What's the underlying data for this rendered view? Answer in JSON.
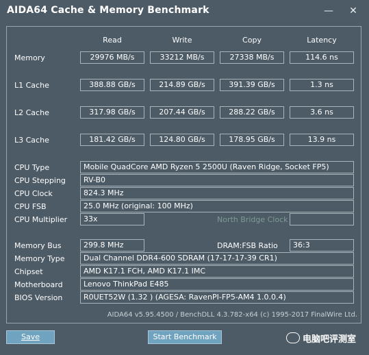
{
  "window": {
    "title": "AIDA64 Cache & Memory Benchmark",
    "minimize_glyph": "—",
    "close_glyph": "✕"
  },
  "headers": [
    "Read",
    "Write",
    "Copy",
    "Latency"
  ],
  "rows": [
    {
      "label": "Memory",
      "values": [
        "29976 MB/s",
        "33212 MB/s",
        "27338 MB/s",
        "114.6 ns"
      ]
    },
    {
      "label": "L1 Cache",
      "values": [
        "388.88 GB/s",
        "214.89 GB/s",
        "391.39 GB/s",
        "1.3 ns"
      ]
    },
    {
      "label": "L2 Cache",
      "values": [
        "317.98 GB/s",
        "207.44 GB/s",
        "288.22 GB/s",
        "3.6 ns"
      ]
    },
    {
      "label": "L3 Cache",
      "values": [
        "181.42 GB/s",
        "124.80 GB/s",
        "178.95 GB/s",
        "13.9 ns"
      ]
    }
  ],
  "info": {
    "cpu_type": {
      "label": "CPU Type",
      "value": "Mobile QuadCore AMD Ryzen 5 2500U  (Raven Ridge, Socket FP5)"
    },
    "cpu_stepping": {
      "label": "CPU Stepping",
      "value": "RV-B0"
    },
    "cpu_clock": {
      "label": "CPU Clock",
      "value": "824.3 MHz"
    },
    "cpu_fsb": {
      "label": "CPU FSB",
      "value": "25.0 MHz  (original: 100 MHz)"
    },
    "cpu_multiplier": {
      "label": "CPU Multiplier",
      "value": "33x"
    },
    "north_bridge_clock": "North Bridge Clock",
    "memory_bus": {
      "label": "Memory Bus",
      "value": "299.8 MHz"
    },
    "dram_fsb": {
      "label": "DRAM:FSB Ratio",
      "value": "36:3"
    },
    "memory_type": {
      "label": "Memory Type",
      "value": "Dual Channel DDR4-600 SDRAM  (17-17-17-39 CR1)"
    },
    "chipset": {
      "label": "Chipset",
      "value": "AMD K17.1 FCH, AMD K17.1 IMC"
    },
    "motherboard": {
      "label": "Motherboard",
      "value": "Lenovo ThinkPad E485"
    },
    "bios": {
      "label": "BIOS Version",
      "value": "R0UET52W (1.32 )  (AGESA: RavenPI-FP5-AM4 1.0.0.4)"
    }
  },
  "footer": "AIDA64 v5.95.4500 / BenchDLL 4.3.782-x64  (c) 1995-2017 FinalWire Ltd.",
  "buttons": {
    "save": "Save",
    "start": "Start Benchmark"
  },
  "watermark": "电脑吧评测室"
}
